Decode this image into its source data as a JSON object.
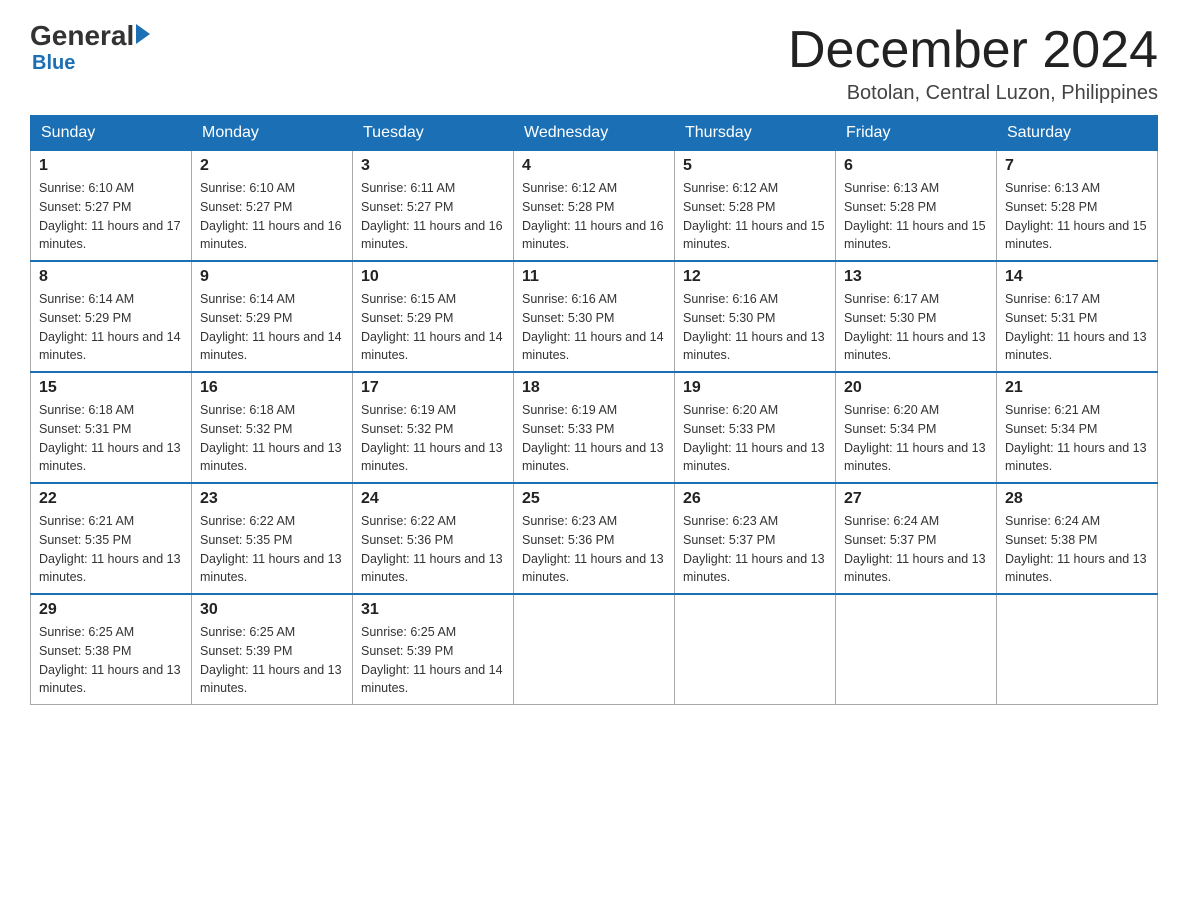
{
  "header": {
    "logo": {
      "general": "General",
      "blue": "Blue"
    },
    "title": "December 2024",
    "location": "Botolan, Central Luzon, Philippines"
  },
  "weekdays": [
    "Sunday",
    "Monday",
    "Tuesday",
    "Wednesday",
    "Thursday",
    "Friday",
    "Saturday"
  ],
  "weeks": [
    [
      {
        "day": "1",
        "sunrise": "Sunrise: 6:10 AM",
        "sunset": "Sunset: 5:27 PM",
        "daylight": "Daylight: 11 hours and 17 minutes."
      },
      {
        "day": "2",
        "sunrise": "Sunrise: 6:10 AM",
        "sunset": "Sunset: 5:27 PM",
        "daylight": "Daylight: 11 hours and 16 minutes."
      },
      {
        "day": "3",
        "sunrise": "Sunrise: 6:11 AM",
        "sunset": "Sunset: 5:27 PM",
        "daylight": "Daylight: 11 hours and 16 minutes."
      },
      {
        "day": "4",
        "sunrise": "Sunrise: 6:12 AM",
        "sunset": "Sunset: 5:28 PM",
        "daylight": "Daylight: 11 hours and 16 minutes."
      },
      {
        "day": "5",
        "sunrise": "Sunrise: 6:12 AM",
        "sunset": "Sunset: 5:28 PM",
        "daylight": "Daylight: 11 hours and 15 minutes."
      },
      {
        "day": "6",
        "sunrise": "Sunrise: 6:13 AM",
        "sunset": "Sunset: 5:28 PM",
        "daylight": "Daylight: 11 hours and 15 minutes."
      },
      {
        "day": "7",
        "sunrise": "Sunrise: 6:13 AM",
        "sunset": "Sunset: 5:28 PM",
        "daylight": "Daylight: 11 hours and 15 minutes."
      }
    ],
    [
      {
        "day": "8",
        "sunrise": "Sunrise: 6:14 AM",
        "sunset": "Sunset: 5:29 PM",
        "daylight": "Daylight: 11 hours and 14 minutes."
      },
      {
        "day": "9",
        "sunrise": "Sunrise: 6:14 AM",
        "sunset": "Sunset: 5:29 PM",
        "daylight": "Daylight: 11 hours and 14 minutes."
      },
      {
        "day": "10",
        "sunrise": "Sunrise: 6:15 AM",
        "sunset": "Sunset: 5:29 PM",
        "daylight": "Daylight: 11 hours and 14 minutes."
      },
      {
        "day": "11",
        "sunrise": "Sunrise: 6:16 AM",
        "sunset": "Sunset: 5:30 PM",
        "daylight": "Daylight: 11 hours and 14 minutes."
      },
      {
        "day": "12",
        "sunrise": "Sunrise: 6:16 AM",
        "sunset": "Sunset: 5:30 PM",
        "daylight": "Daylight: 11 hours and 13 minutes."
      },
      {
        "day": "13",
        "sunrise": "Sunrise: 6:17 AM",
        "sunset": "Sunset: 5:30 PM",
        "daylight": "Daylight: 11 hours and 13 minutes."
      },
      {
        "day": "14",
        "sunrise": "Sunrise: 6:17 AM",
        "sunset": "Sunset: 5:31 PM",
        "daylight": "Daylight: 11 hours and 13 minutes."
      }
    ],
    [
      {
        "day": "15",
        "sunrise": "Sunrise: 6:18 AM",
        "sunset": "Sunset: 5:31 PM",
        "daylight": "Daylight: 11 hours and 13 minutes."
      },
      {
        "day": "16",
        "sunrise": "Sunrise: 6:18 AM",
        "sunset": "Sunset: 5:32 PM",
        "daylight": "Daylight: 11 hours and 13 minutes."
      },
      {
        "day": "17",
        "sunrise": "Sunrise: 6:19 AM",
        "sunset": "Sunset: 5:32 PM",
        "daylight": "Daylight: 11 hours and 13 minutes."
      },
      {
        "day": "18",
        "sunrise": "Sunrise: 6:19 AM",
        "sunset": "Sunset: 5:33 PM",
        "daylight": "Daylight: 11 hours and 13 minutes."
      },
      {
        "day": "19",
        "sunrise": "Sunrise: 6:20 AM",
        "sunset": "Sunset: 5:33 PM",
        "daylight": "Daylight: 11 hours and 13 minutes."
      },
      {
        "day": "20",
        "sunrise": "Sunrise: 6:20 AM",
        "sunset": "Sunset: 5:34 PM",
        "daylight": "Daylight: 11 hours and 13 minutes."
      },
      {
        "day": "21",
        "sunrise": "Sunrise: 6:21 AM",
        "sunset": "Sunset: 5:34 PM",
        "daylight": "Daylight: 11 hours and 13 minutes."
      }
    ],
    [
      {
        "day": "22",
        "sunrise": "Sunrise: 6:21 AM",
        "sunset": "Sunset: 5:35 PM",
        "daylight": "Daylight: 11 hours and 13 minutes."
      },
      {
        "day": "23",
        "sunrise": "Sunrise: 6:22 AM",
        "sunset": "Sunset: 5:35 PM",
        "daylight": "Daylight: 11 hours and 13 minutes."
      },
      {
        "day": "24",
        "sunrise": "Sunrise: 6:22 AM",
        "sunset": "Sunset: 5:36 PM",
        "daylight": "Daylight: 11 hours and 13 minutes."
      },
      {
        "day": "25",
        "sunrise": "Sunrise: 6:23 AM",
        "sunset": "Sunset: 5:36 PM",
        "daylight": "Daylight: 11 hours and 13 minutes."
      },
      {
        "day": "26",
        "sunrise": "Sunrise: 6:23 AM",
        "sunset": "Sunset: 5:37 PM",
        "daylight": "Daylight: 11 hours and 13 minutes."
      },
      {
        "day": "27",
        "sunrise": "Sunrise: 6:24 AM",
        "sunset": "Sunset: 5:37 PM",
        "daylight": "Daylight: 11 hours and 13 minutes."
      },
      {
        "day": "28",
        "sunrise": "Sunrise: 6:24 AM",
        "sunset": "Sunset: 5:38 PM",
        "daylight": "Daylight: 11 hours and 13 minutes."
      }
    ],
    [
      {
        "day": "29",
        "sunrise": "Sunrise: 6:25 AM",
        "sunset": "Sunset: 5:38 PM",
        "daylight": "Daylight: 11 hours and 13 minutes."
      },
      {
        "day": "30",
        "sunrise": "Sunrise: 6:25 AM",
        "sunset": "Sunset: 5:39 PM",
        "daylight": "Daylight: 11 hours and 13 minutes."
      },
      {
        "day": "31",
        "sunrise": "Sunrise: 6:25 AM",
        "sunset": "Sunset: 5:39 PM",
        "daylight": "Daylight: 11 hours and 14 minutes."
      },
      null,
      null,
      null,
      null
    ]
  ]
}
